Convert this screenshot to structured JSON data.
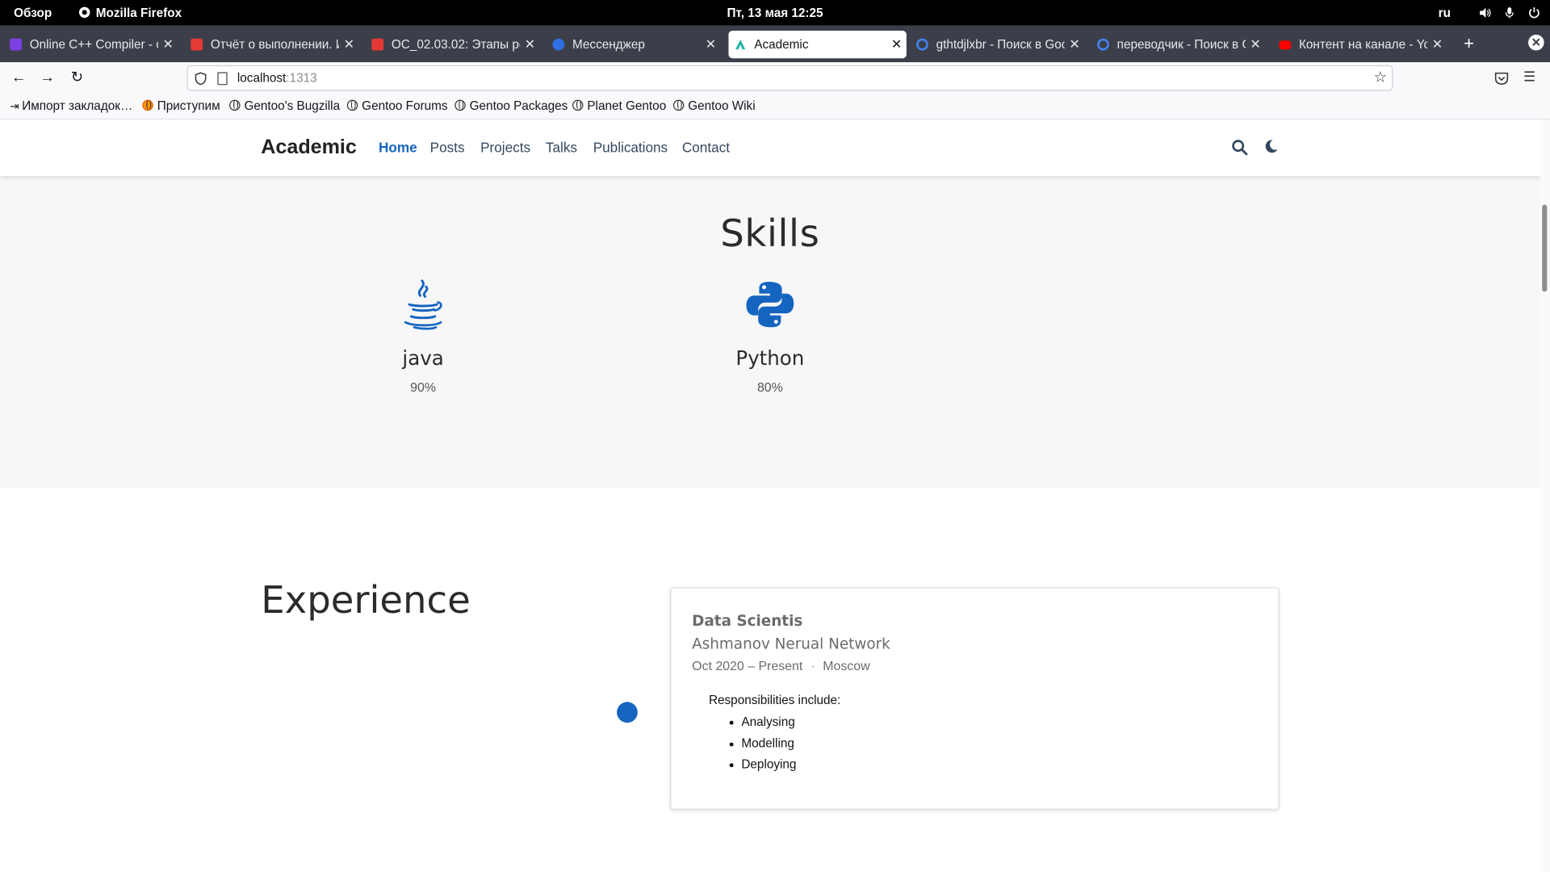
{
  "system_bar": {
    "activities": "Обзор",
    "app_name": "Mozilla Firefox",
    "datetime": "Пт, 13 мая  12:25",
    "lang": "ru"
  },
  "tabs": [
    {
      "title": "Online C++ Compiler - onl",
      "favicon_color": "#7b3fe4"
    },
    {
      "title": "Отчёт о выполнении. Ин",
      "favicon_color": "#e53935"
    },
    {
      "title": "ОС_02.03.02: Этапы реа",
      "favicon_color": "#e53935"
    },
    {
      "title": "Мессенджер",
      "favicon_color": "#2f6fe4"
    },
    {
      "title": "Academic",
      "favicon_color": "#20b2aa"
    },
    {
      "title": "gthtdjlxbr - Поиск в Goog",
      "favicon_color": "#4285f4"
    },
    {
      "title": "переводчик - Поиск в Go",
      "favicon_color": "#4285f4"
    },
    {
      "title": "Контент на канале - You",
      "favicon_color": "#ff0000"
    }
  ],
  "toolbar": {
    "url_host": "localhost",
    "url_port": ":1313"
  },
  "bookmarks": [
    {
      "label": "Импорт закладок…"
    },
    {
      "label": "Приступим"
    },
    {
      "label": "Gentoo's Bugzilla"
    },
    {
      "label": "Gentoo Forums"
    },
    {
      "label": "Gentoo Packages"
    },
    {
      "label": "Planet Gentoo"
    },
    {
      "label": "Gentoo Wiki"
    }
  ],
  "site": {
    "brand": "Academic",
    "nav": [
      {
        "label": "Home",
        "active": true
      },
      {
        "label": "Posts"
      },
      {
        "label": "Projects"
      },
      {
        "label": "Talks"
      },
      {
        "label": "Publications"
      },
      {
        "label": "Contact"
      }
    ],
    "skills": {
      "title": "Skills",
      "items": [
        {
          "name": "java",
          "percent": "90%",
          "icon": "java-icon",
          "color": "#1565c0"
        },
        {
          "name": "Python",
          "percent": "80%",
          "icon": "python-icon",
          "color": "#1565c0"
        }
      ]
    },
    "experience": {
      "title": "Experience",
      "items": [
        {
          "role": "Data Scientis",
          "company": "Ashmanov Nerual Network",
          "dates": "Oct 2020 – Present",
          "separator": "·",
          "location": "Moscow",
          "description": "Responsibilities include:",
          "bullets": [
            "Analysing",
            "Modelling",
            "Deploying"
          ]
        }
      ]
    },
    "accent_color": "#1565c0"
  }
}
